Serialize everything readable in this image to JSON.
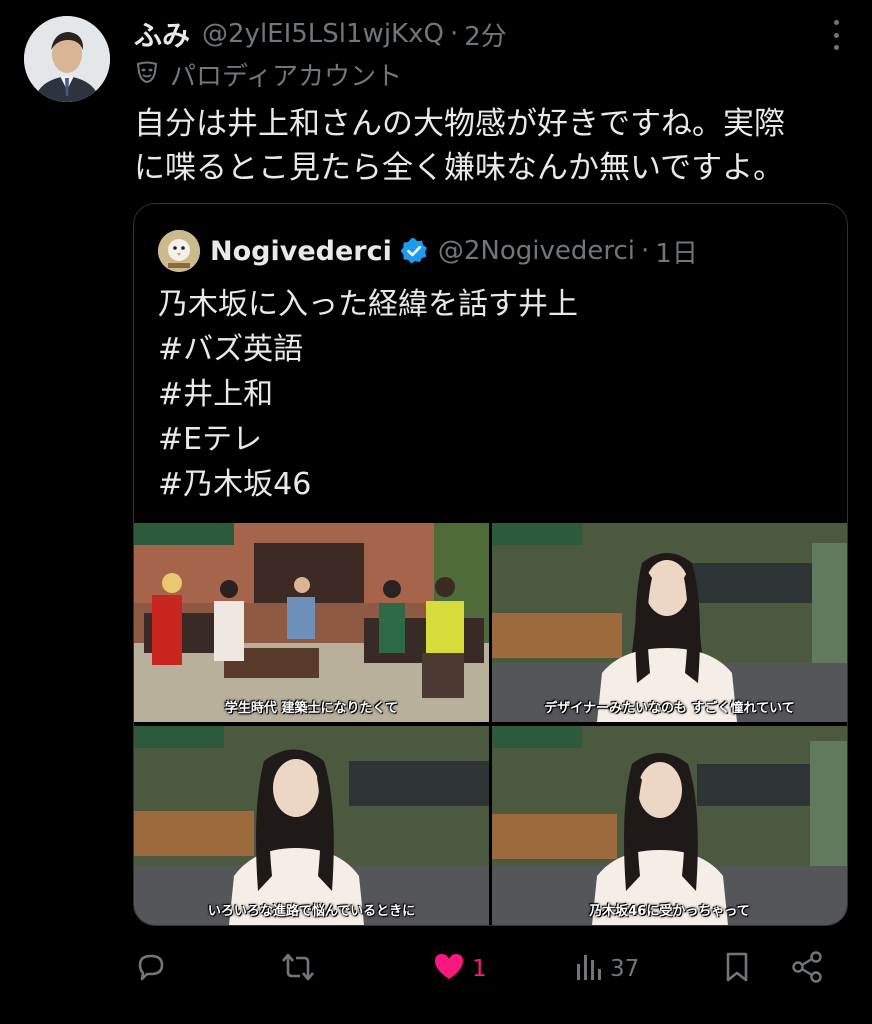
{
  "tweet": {
    "display_name": "ふみ",
    "handle": "@2ylEI5LSl1wjKxQ",
    "separator": "·",
    "time": "2分",
    "label_icon": "theater-mask-icon",
    "label": "パロディアカウント",
    "text": "自分は井上和さんの大物感が好きですね。実際\nに喋るとこ見たら全く嫌味なんか無いですよ。"
  },
  "quote": {
    "display_name": "Nogivederci",
    "verified": true,
    "handle": "@2Nogivederci",
    "separator": "·",
    "time": "1日",
    "text": "乃木坂に入った経緯を話す井上\n#バズ英語\n#井上和\n#Eテレ\n#乃木坂46",
    "images": [
      {
        "subtitle": "学生時代 建築士になりたくて"
      },
      {
        "subtitle": "デザイナーみたいなのも すごく憧れていて"
      },
      {
        "subtitle": "いろいろな進路で悩んでいるときに"
      },
      {
        "subtitle": "乃木坂46に受かっちゃって"
      }
    ]
  },
  "actions": {
    "reply_icon": "reply-icon",
    "retweet_icon": "retweet-icon",
    "like_icon": "heart-icon",
    "like_count": "1",
    "views_icon": "views-chart-icon",
    "views_count": "37",
    "bookmark_icon": "bookmark-icon",
    "share_icon": "share-icon"
  },
  "colors": {
    "background": "#000000",
    "text": "#e7e9ea",
    "muted": "#71767b",
    "like": "#f91880",
    "verified": "#1d9bf0",
    "border": "#2f3336"
  }
}
